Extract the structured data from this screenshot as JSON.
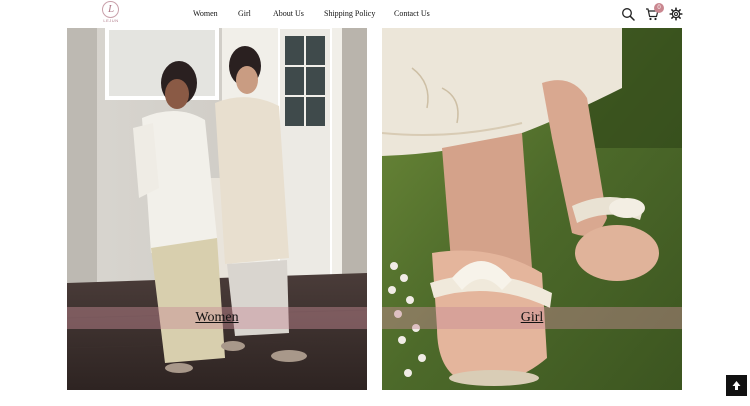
{
  "header": {
    "logo": {
      "mark": "L",
      "text": "LEJUN"
    },
    "nav": [
      {
        "label": "Women"
      },
      {
        "label": "Girl"
      },
      {
        "label": "About Us"
      },
      {
        "label": "Shipping Policy"
      },
      {
        "label": "Contact Us"
      }
    ],
    "icons": {
      "search": "search-icon",
      "cart": "cart-icon",
      "settings": "gear-icon"
    },
    "cart_count": "0"
  },
  "collections": [
    {
      "label": "Women"
    },
    {
      "label": "Girl"
    }
  ],
  "colors": {
    "accent": "#c9868f",
    "banner": "#c88c96",
    "scroll_top_bg": "#111111"
  },
  "scroll_top": {
    "icon": "arrow-up-icon"
  }
}
